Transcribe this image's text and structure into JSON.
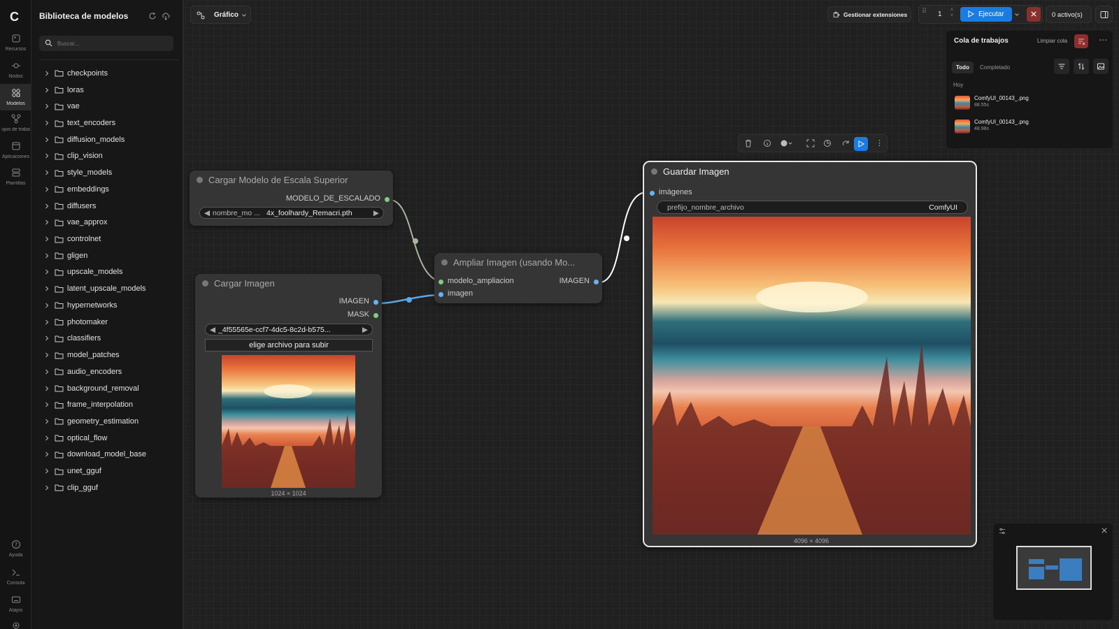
{
  "sidebar": {
    "items": [
      {
        "label": "Recursos",
        "icon": "resources-icon"
      },
      {
        "label": "Nodos",
        "icon": "nodes-icon"
      },
      {
        "label": "Modelos",
        "icon": "models-icon"
      },
      {
        "label": "ujos de traba",
        "icon": "workflows-icon"
      },
      {
        "label": "Aplicaciones",
        "icon": "apps-icon"
      },
      {
        "label": "Plantillas",
        "icon": "templates-icon"
      }
    ],
    "bottom": [
      {
        "label": "Ayuda",
        "icon": "help-icon"
      },
      {
        "label": "Consola",
        "icon": "console-icon"
      },
      {
        "label": "Atajos",
        "icon": "keyboard-icon"
      }
    ]
  },
  "library": {
    "title": "Biblioteca de modelos",
    "search_placeholder": "Buscar...",
    "folders": [
      "checkpoints",
      "loras",
      "vae",
      "text_encoders",
      "diffusion_models",
      "clip_vision",
      "style_models",
      "embeddings",
      "diffusers",
      "vae_approx",
      "controlnet",
      "gligen",
      "upscale_models",
      "latent_upscale_models",
      "hypernetworks",
      "photomaker",
      "classifiers",
      "model_patches",
      "audio_encoders",
      "background_removal",
      "frame_interpolation",
      "geometry_estimation",
      "optical_flow",
      "download_model_base",
      "unet_gguf",
      "clip_gguf"
    ]
  },
  "topbar": {
    "graph_tab": "Gráfico",
    "manage_extensions": "Gestionar extensiones",
    "batch_count": "1",
    "run_label": "Ejecutar",
    "active_count": "0 activo(s)"
  },
  "queue": {
    "title": "Cola de trabajos",
    "clear_label": "Limpiar cola",
    "tabs": [
      "Todo",
      "Completado"
    ],
    "day_label": "Hoy",
    "items": [
      {
        "name": "ComfyUI_00143_.png",
        "time": "88.55s"
      },
      {
        "name": "ComfyUI_00143_.png",
        "time": "48.98s"
      }
    ]
  },
  "nodes": {
    "upscale_loader": {
      "title": "Cargar Modelo de Escala Superior",
      "output": "MODELO_DE_ESCALADO",
      "widget_label": "nombre_mo ...",
      "widget_value": "4x_foolhardy_Remacri.pth"
    },
    "load_image": {
      "title": "Cargar Imagen",
      "outputs": [
        "IMAGEN",
        "MASK"
      ],
      "widget_value": "_4f55565e-ccf7-4dc5-8c2d-b575...",
      "upload_label": "elige archivo para subir",
      "image_size": "1024 × 1024"
    },
    "upscale_image": {
      "title": "Ampliar Imagen (usando Mo...",
      "inputs": [
        "modelo_ampliacion",
        "imagen"
      ],
      "output": "IMAGEN"
    },
    "save_image": {
      "title": "Guardar Imagen",
      "input": "imágenes",
      "widget_label": "prefijo_nombre_archivo",
      "widget_value": "ComfyUI",
      "image_size": "4096 × 4096"
    }
  },
  "colors": {
    "accent": "#1a7be0",
    "model_slot": "#7ed07e",
    "image_slot": "#64b5f6",
    "danger": "#8a2e2e"
  }
}
